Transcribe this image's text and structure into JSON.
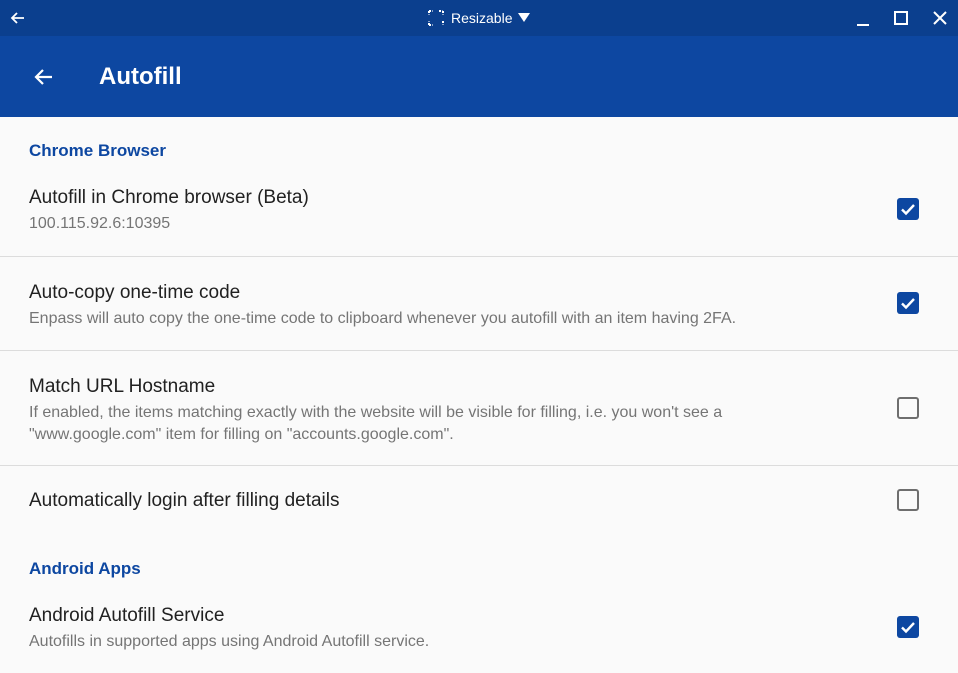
{
  "titlebar": {
    "back_icon": "arrow-left-icon",
    "mode_label": "Resizable",
    "mode_icon": "resize-icon",
    "dropdown_icon": "caret-down-icon",
    "minimize_icon": "minimize-icon",
    "maximize_icon": "maximize-icon",
    "close_icon": "close-icon"
  },
  "appbar": {
    "back_icon": "arrow-left-icon",
    "title": "Autofill"
  },
  "colors": {
    "titlebar": "#0b3f8e",
    "appbar": "#0d47a1",
    "accent": "#0d47a1",
    "background": "#fafafa"
  },
  "sections": [
    {
      "header": "Chrome Browser",
      "items": [
        {
          "title": "Autofill in Chrome browser (Beta)",
          "subtitle": "100.115.92.6:10395",
          "checked": true
        },
        {
          "title": "Auto-copy one-time code",
          "subtitle": "Enpass will auto copy the one-time code to clipboard whenever you autofill with an item having 2FA.",
          "checked": true
        },
        {
          "title": "Match URL Hostname",
          "subtitle": "If enabled, the items matching exactly with the website will be visible for filling, i.e. you won't see a \"www.google.com\" item for filling on \"accounts.google.com\".",
          "checked": false
        },
        {
          "title": "Automatically login after filling details",
          "subtitle": "",
          "checked": false
        }
      ]
    },
    {
      "header": "Android Apps",
      "items": [
        {
          "title": "Android Autofill Service",
          "subtitle": "Autofills in supported apps using Android Autofill service.",
          "checked": true
        }
      ]
    }
  ]
}
